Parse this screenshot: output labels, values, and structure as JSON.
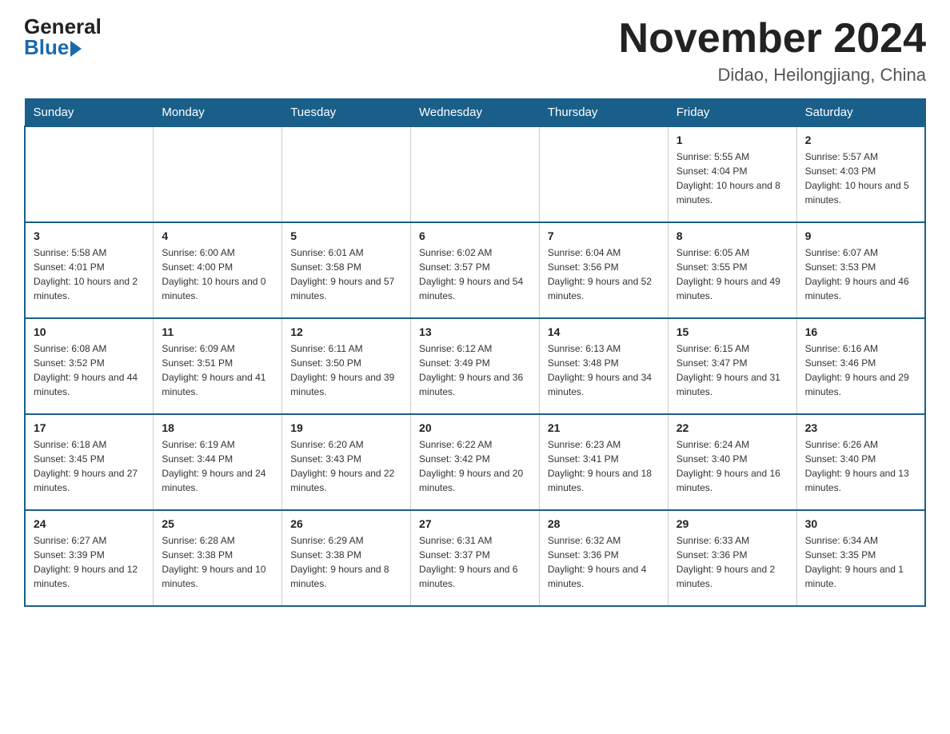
{
  "header": {
    "logo_general": "General",
    "logo_blue": "Blue",
    "month_title": "November 2024",
    "location": "Didao, Heilongjiang, China"
  },
  "days_of_week": [
    "Sunday",
    "Monday",
    "Tuesday",
    "Wednesday",
    "Thursday",
    "Friday",
    "Saturday"
  ],
  "weeks": [
    {
      "days": [
        {
          "num": "",
          "info": ""
        },
        {
          "num": "",
          "info": ""
        },
        {
          "num": "",
          "info": ""
        },
        {
          "num": "",
          "info": ""
        },
        {
          "num": "",
          "info": ""
        },
        {
          "num": "1",
          "info": "Sunrise: 5:55 AM\nSunset: 4:04 PM\nDaylight: 10 hours and 8 minutes."
        },
        {
          "num": "2",
          "info": "Sunrise: 5:57 AM\nSunset: 4:03 PM\nDaylight: 10 hours and 5 minutes."
        }
      ]
    },
    {
      "days": [
        {
          "num": "3",
          "info": "Sunrise: 5:58 AM\nSunset: 4:01 PM\nDaylight: 10 hours and 2 minutes."
        },
        {
          "num": "4",
          "info": "Sunrise: 6:00 AM\nSunset: 4:00 PM\nDaylight: 10 hours and 0 minutes."
        },
        {
          "num": "5",
          "info": "Sunrise: 6:01 AM\nSunset: 3:58 PM\nDaylight: 9 hours and 57 minutes."
        },
        {
          "num": "6",
          "info": "Sunrise: 6:02 AM\nSunset: 3:57 PM\nDaylight: 9 hours and 54 minutes."
        },
        {
          "num": "7",
          "info": "Sunrise: 6:04 AM\nSunset: 3:56 PM\nDaylight: 9 hours and 52 minutes."
        },
        {
          "num": "8",
          "info": "Sunrise: 6:05 AM\nSunset: 3:55 PM\nDaylight: 9 hours and 49 minutes."
        },
        {
          "num": "9",
          "info": "Sunrise: 6:07 AM\nSunset: 3:53 PM\nDaylight: 9 hours and 46 minutes."
        }
      ]
    },
    {
      "days": [
        {
          "num": "10",
          "info": "Sunrise: 6:08 AM\nSunset: 3:52 PM\nDaylight: 9 hours and 44 minutes."
        },
        {
          "num": "11",
          "info": "Sunrise: 6:09 AM\nSunset: 3:51 PM\nDaylight: 9 hours and 41 minutes."
        },
        {
          "num": "12",
          "info": "Sunrise: 6:11 AM\nSunset: 3:50 PM\nDaylight: 9 hours and 39 minutes."
        },
        {
          "num": "13",
          "info": "Sunrise: 6:12 AM\nSunset: 3:49 PM\nDaylight: 9 hours and 36 minutes."
        },
        {
          "num": "14",
          "info": "Sunrise: 6:13 AM\nSunset: 3:48 PM\nDaylight: 9 hours and 34 minutes."
        },
        {
          "num": "15",
          "info": "Sunrise: 6:15 AM\nSunset: 3:47 PM\nDaylight: 9 hours and 31 minutes."
        },
        {
          "num": "16",
          "info": "Sunrise: 6:16 AM\nSunset: 3:46 PM\nDaylight: 9 hours and 29 minutes."
        }
      ]
    },
    {
      "days": [
        {
          "num": "17",
          "info": "Sunrise: 6:18 AM\nSunset: 3:45 PM\nDaylight: 9 hours and 27 minutes."
        },
        {
          "num": "18",
          "info": "Sunrise: 6:19 AM\nSunset: 3:44 PM\nDaylight: 9 hours and 24 minutes."
        },
        {
          "num": "19",
          "info": "Sunrise: 6:20 AM\nSunset: 3:43 PM\nDaylight: 9 hours and 22 minutes."
        },
        {
          "num": "20",
          "info": "Sunrise: 6:22 AM\nSunset: 3:42 PM\nDaylight: 9 hours and 20 minutes."
        },
        {
          "num": "21",
          "info": "Sunrise: 6:23 AM\nSunset: 3:41 PM\nDaylight: 9 hours and 18 minutes."
        },
        {
          "num": "22",
          "info": "Sunrise: 6:24 AM\nSunset: 3:40 PM\nDaylight: 9 hours and 16 minutes."
        },
        {
          "num": "23",
          "info": "Sunrise: 6:26 AM\nSunset: 3:40 PM\nDaylight: 9 hours and 13 minutes."
        }
      ]
    },
    {
      "days": [
        {
          "num": "24",
          "info": "Sunrise: 6:27 AM\nSunset: 3:39 PM\nDaylight: 9 hours and 12 minutes."
        },
        {
          "num": "25",
          "info": "Sunrise: 6:28 AM\nSunset: 3:38 PM\nDaylight: 9 hours and 10 minutes."
        },
        {
          "num": "26",
          "info": "Sunrise: 6:29 AM\nSunset: 3:38 PM\nDaylight: 9 hours and 8 minutes."
        },
        {
          "num": "27",
          "info": "Sunrise: 6:31 AM\nSunset: 3:37 PM\nDaylight: 9 hours and 6 minutes."
        },
        {
          "num": "28",
          "info": "Sunrise: 6:32 AM\nSunset: 3:36 PM\nDaylight: 9 hours and 4 minutes."
        },
        {
          "num": "29",
          "info": "Sunrise: 6:33 AM\nSunset: 3:36 PM\nDaylight: 9 hours and 2 minutes."
        },
        {
          "num": "30",
          "info": "Sunrise: 6:34 AM\nSunset: 3:35 PM\nDaylight: 9 hours and 1 minute."
        }
      ]
    }
  ]
}
